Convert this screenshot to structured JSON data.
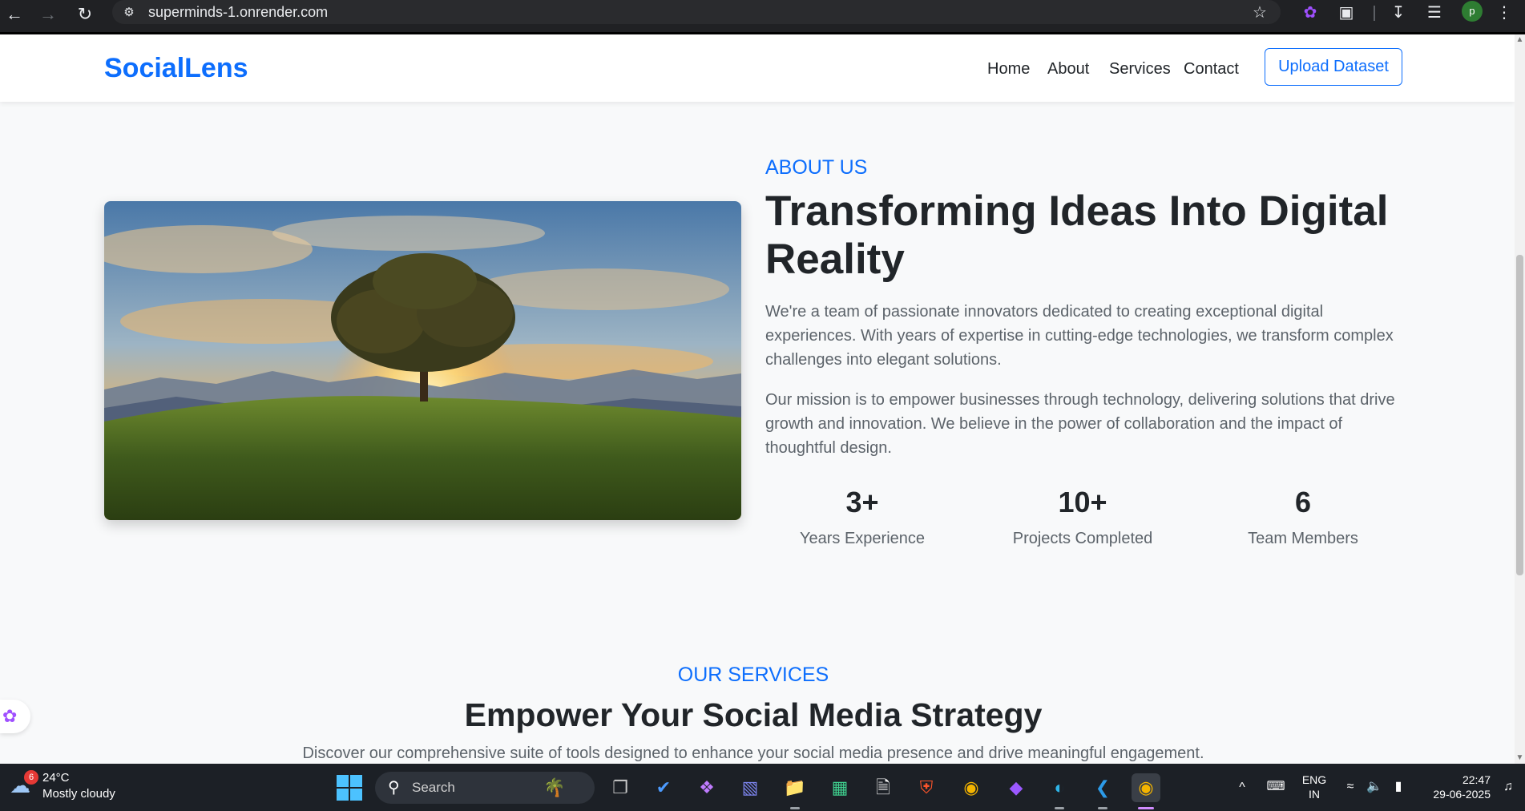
{
  "browser": {
    "url": "superminds-1.onrender.com",
    "profile_initial": "p"
  },
  "header": {
    "brand": "SocialLens",
    "nav": [
      "Home",
      "About",
      "Services",
      "Contact"
    ],
    "cta": "Upload Dataset"
  },
  "about": {
    "eyebrow": "ABOUT US",
    "title": "Transforming Ideas Into Digital Reality",
    "paragraphs": [
      "We're a team of passionate innovators dedicated to creating exceptional digital experiences. With years of expertise in cutting-edge technologies, we transform complex challenges into elegant solutions.",
      "Our mission is to empower businesses through technology, delivering solutions that drive growth and innovation. We believe in the power of collaboration and the impact of thoughtful design."
    ],
    "stats": [
      {
        "value": "3+",
        "label": "Years Experience"
      },
      {
        "value": "10+",
        "label": "Projects Completed"
      },
      {
        "value": "6",
        "label": "Team Members"
      }
    ]
  },
  "services": {
    "eyebrow": "OUR SERVICES",
    "title": "Empower Your Social Media Strategy",
    "subtitle": "Discover our comprehensive suite of tools designed to enhance your social media presence and drive meaningful engagement."
  },
  "taskbar": {
    "weather_badge": "6",
    "temperature": "24°C",
    "condition": "Mostly cloudy",
    "search_placeholder": "Search",
    "lang_line1": "ENG",
    "lang_line2": "IN",
    "time": "22:47",
    "date": "29-06-2025"
  },
  "colors": {
    "accent": "#0d6efd",
    "heading": "#212529",
    "body_text": "#5c636a",
    "page_bg": "#f8f9fa",
    "taskbar_bg": "#1c2026"
  }
}
